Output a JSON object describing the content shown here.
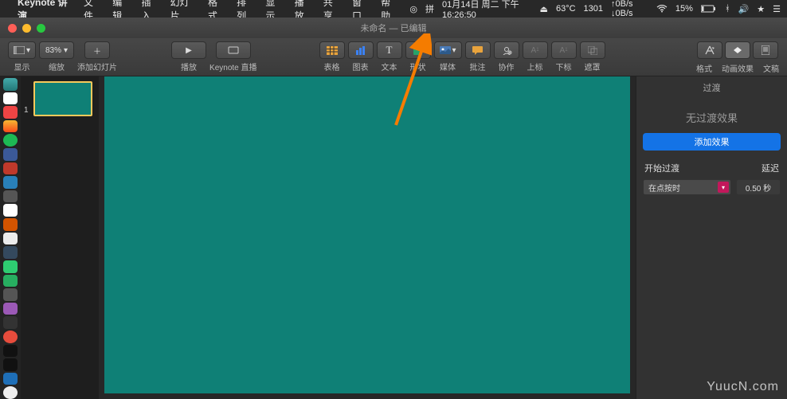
{
  "menubar": {
    "app": "Keynote 讲演",
    "items": [
      "文件",
      "编辑",
      "插入",
      "幻灯片",
      "格式",
      "排列",
      "显示",
      "播放",
      "共享",
      "窗口",
      "帮助"
    ],
    "date": "01月14日 周二 下午16:26:50",
    "temp": "63°C",
    "rpm": "1301",
    "net": "↑0B/s ↓0B/s",
    "battery": "15%"
  },
  "window": {
    "title": "未命名 — 已编辑"
  },
  "toolbar": {
    "view": "显示",
    "zoom_value": "83%",
    "zoom": "缩放",
    "add_slide": "添加幻灯片",
    "play": "播放",
    "live": "Keynote 直播",
    "table": "表格",
    "chart": "图表",
    "text": "文本",
    "shape": "形状",
    "media": "媒体",
    "comment": "批注",
    "collab": "协作",
    "sup": "上标",
    "sub": "下标",
    "mask": "遮罩",
    "format": "格式",
    "animate": "动画效果",
    "document": "文稿"
  },
  "thumbnails": {
    "first_index": "1"
  },
  "inspector": {
    "tab_title": "过渡",
    "none_label": "无过渡效果",
    "add_effect": "添加效果",
    "start_label": "开始过渡",
    "delay_label": "延迟",
    "start_value": "在点按时",
    "delay_value": "0.50 秒"
  },
  "watermark": "YuucN.com",
  "colors": {
    "slide": "#0f8076",
    "accent": "#1473e6"
  }
}
